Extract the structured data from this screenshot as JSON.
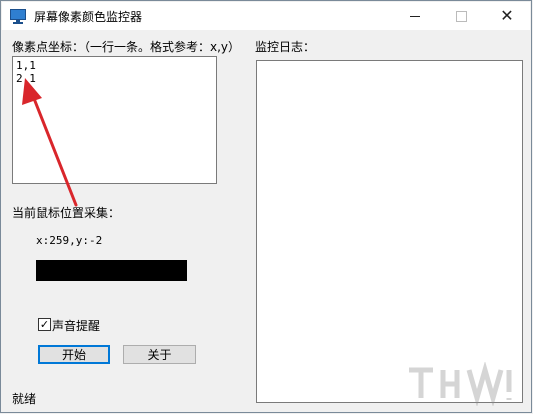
{
  "window": {
    "title": "屏幕像素颜色监控器",
    "icon": "monitor-icon",
    "controls": [
      "minimize-icon",
      "maximize-icon",
      "close-icon"
    ]
  },
  "coords": {
    "label": "像素点坐标：（一行一条。格式参考：x,y）",
    "lines": [
      "1,1",
      "2,1"
    ]
  },
  "log": {
    "label": "监控日志："
  },
  "capture": {
    "label": "当前鼠标位置采集：",
    "position_text": "x:259,y:-2",
    "color": "#000000"
  },
  "sound_alert": {
    "label": "声音提醒",
    "checked": true
  },
  "buttons": {
    "start": "开始",
    "about": "关于"
  },
  "status": "就绪",
  "annotation": {
    "color": "#d9262b"
  }
}
